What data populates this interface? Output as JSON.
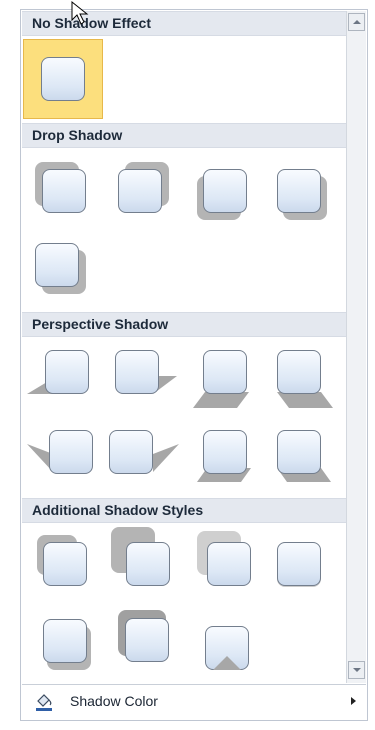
{
  "sections": {
    "no_shadow": "No Shadow Effect",
    "drop_shadow": "Drop Shadow",
    "perspective_shadow": "Perspective Shadow",
    "additional_shadow": "Additional Shadow Styles"
  },
  "footer": {
    "shadow_color_label": "Shadow Color"
  },
  "icons": {
    "shadow_color": "paint-bucket-icon",
    "submenu": "chevron-right-icon",
    "scroll_up": "arrow-up-icon",
    "scroll_down": "arrow-down-icon"
  },
  "colors": {
    "selected_bg": "#fcdf7d",
    "header_bg": "#e4e8ef",
    "shadow": "#a7a7a7"
  }
}
